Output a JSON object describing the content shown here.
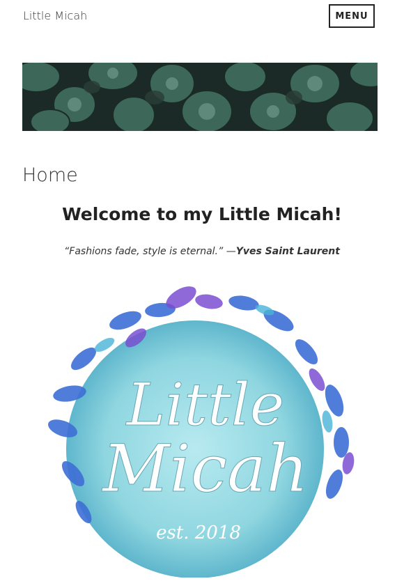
{
  "header": {
    "site_title": "Little Micah",
    "menu_label": "MENU"
  },
  "page": {
    "title": "Home",
    "welcome_heading": "Welcome to my Little Micah!",
    "quote_text": "“Fashions fade, style is eternal.” —",
    "quote_author": "Yves Saint Laurent"
  },
  "logo": {
    "line1": "Little",
    "line2": "Micah",
    "established": "est. 2018"
  },
  "colors": {
    "succulent_dark": "#1b2a26",
    "succulent_green": "#4f7a6a",
    "leaf_blue": "#3f6fd6",
    "leaf_purple": "#7a4fd0",
    "circle_teal": "#8fd6e0"
  }
}
